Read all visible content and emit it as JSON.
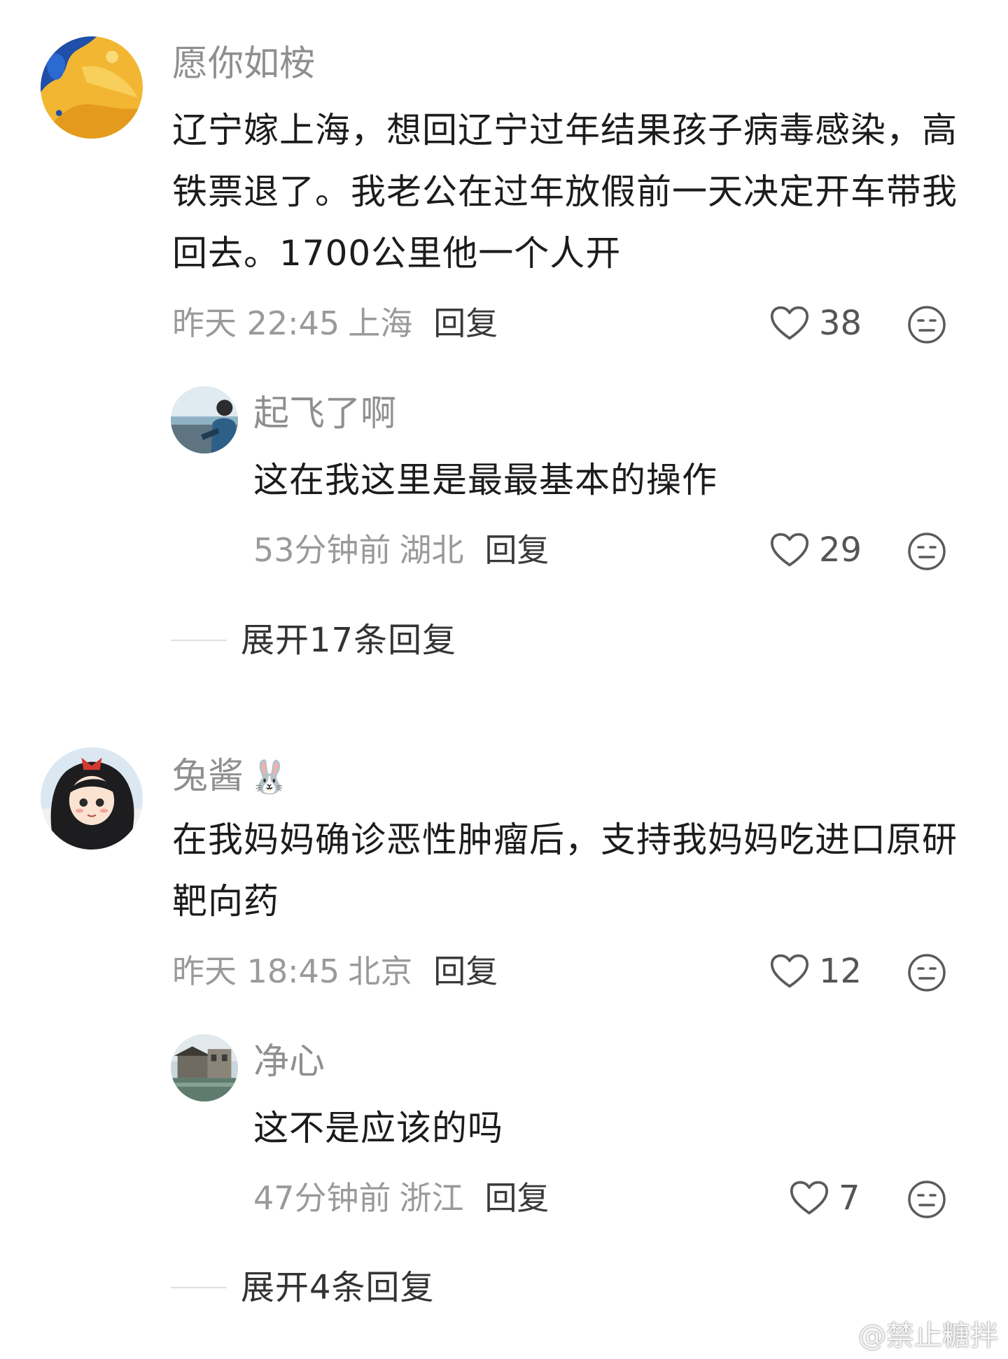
{
  "comments": [
    {
      "username": "愿你如桉",
      "text": "辽宁嫁上海，想回辽宁过年结果孩子病毒感染，高铁票退了。我老公在过年放假前一天决定开车带我回去。1700公里他一个人开",
      "time": "昨天 22:45",
      "location": "上海",
      "reply_label": "回复",
      "likes": "38",
      "reply": {
        "username": "起飞了啊",
        "text": "这在我这里是最最基本的操作",
        "time": "53分钟前",
        "location": "湖北",
        "reply_label": "回复",
        "likes": "29"
      },
      "expand_label": "展开17条回复"
    },
    {
      "username": "兔酱",
      "username_emoji": "🐰",
      "text": "在我妈妈确诊恶性肿瘤后，支持我妈妈吃进口原研靶向药",
      "time": "昨天 18:45",
      "location": "北京",
      "reply_label": "回复",
      "likes": "12",
      "reply": {
        "username": "净心",
        "text": "这不是应该的吗",
        "time": "47分钟前",
        "location": "浙江",
        "reply_label": "回复",
        "likes": "7"
      },
      "expand_label": "展开4条回复"
    }
  ],
  "watermark": "@禁止糖拌",
  "icons": {
    "like": "heart-outline-icon",
    "dislike": "meh-face-icon",
    "weibo": "weibo-logo-icon"
  }
}
